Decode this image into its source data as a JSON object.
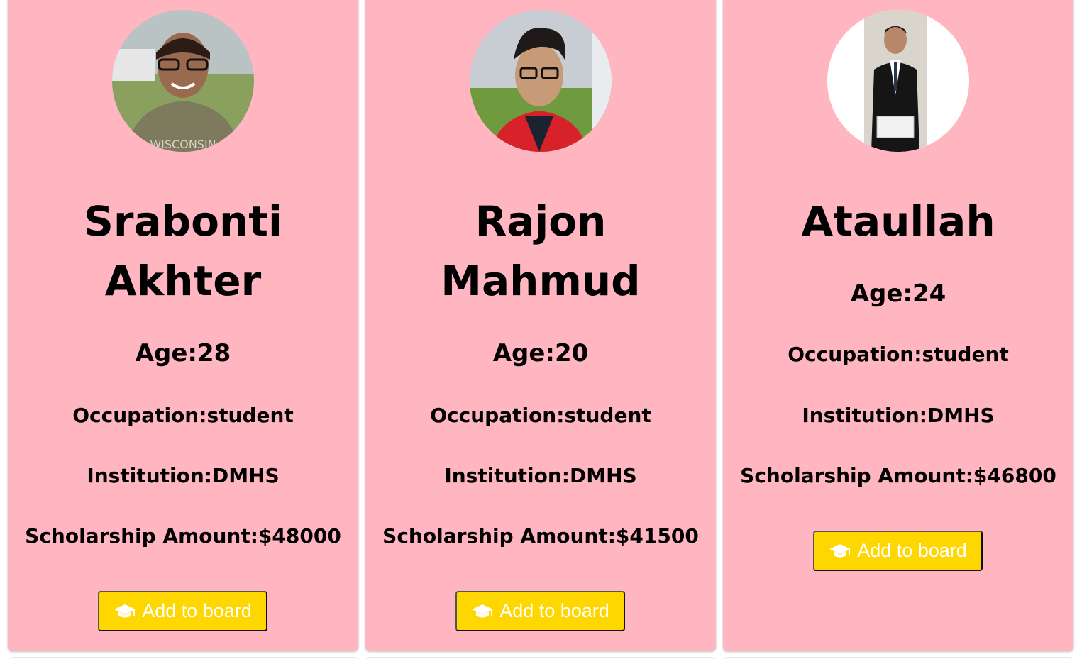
{
  "colors": {
    "card_background": "#ffb6c1",
    "button_background": "#ffd700",
    "button_text": "#ffffff"
  },
  "cards": [
    {
      "name": "Srabonti Akhter",
      "age": "Age:28",
      "occupation": "Occupation:student",
      "institution": "Institution:DMHS",
      "scholarship": "Scholarship Amount:$48000",
      "button_label": "Add to board",
      "button_icon": "graduation-cap-icon"
    },
    {
      "name": "Rajon Mahmud",
      "age": "Age:20",
      "occupation": "Occupation:student",
      "institution": "Institution:DMHS",
      "scholarship": "Scholarship Amount:$41500",
      "button_label": "Add to board",
      "button_icon": "graduation-cap-icon"
    },
    {
      "name": "Ataullah",
      "age": "Age:24",
      "occupation": "Occupation:student",
      "institution": "Institution:DMHS",
      "scholarship": "Scholarship Amount:$46800",
      "button_label": "Add to board",
      "button_icon": "graduation-cap-icon"
    }
  ]
}
